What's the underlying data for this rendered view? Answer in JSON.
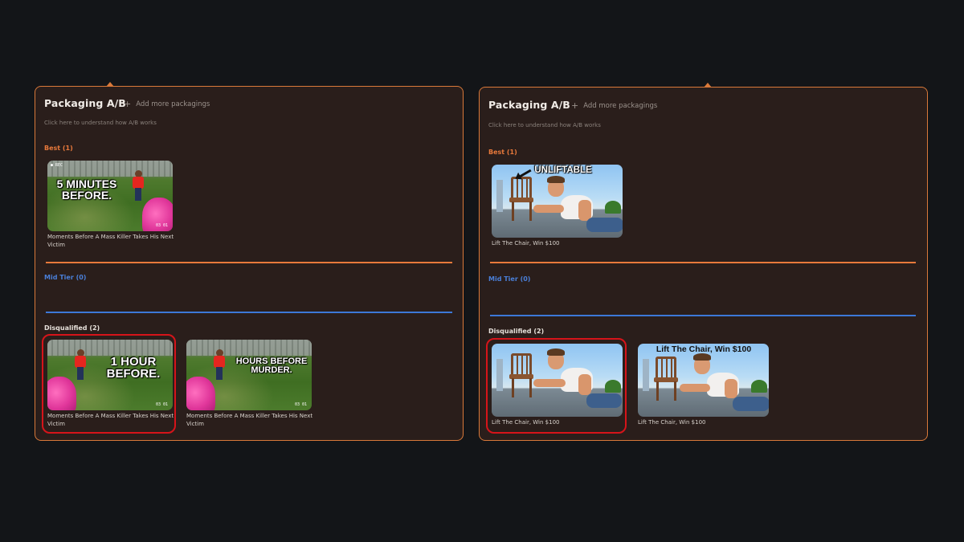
{
  "panels": [
    {
      "title": "Packaging A/B",
      "add_more_label": "Add more packagings",
      "help_text": "Click here to understand how A/B works",
      "tiers": {
        "best": "Best (1)",
        "mid": "Mid Tier (0)",
        "disqualified": "Disqualified (2)"
      },
      "best_cards": [
        {
          "thumb_text": "5 MINUTES BEFORE.",
          "title": "Moments Before A Mass Killer Takes His Next Victim"
        }
      ],
      "disqualified_cards": [
        {
          "thumb_text": "1 HOUR BEFORE.",
          "title": "Moments Before A Mass Killer Takes His Next Victim",
          "highlighted": true
        },
        {
          "thumb_text": "HOURS BEFORE MURDER.",
          "title": "Moments Before A Mass Killer Takes His Next Victim",
          "highlighted": false
        }
      ]
    },
    {
      "title": "Packaging A/B",
      "add_more_label": "Add more packagings",
      "help_text": "Click here to understand how A/B works",
      "tiers": {
        "best": "Best (1)",
        "mid": "Mid Tier (0)",
        "disqualified": "Disqualified (2)"
      },
      "best_cards": [
        {
          "thumb_text": "UNLIFTABLE",
          "title": "Lift The Chair, Win $100"
        }
      ],
      "disqualified_cards": [
        {
          "thumb_text": "",
          "title": "Lift The Chair, Win $100",
          "highlighted": true
        },
        {
          "thumb_text": "Lift The Chair, Win $100",
          "title": "Lift The Chair, Win $100",
          "highlighted": false
        }
      ]
    }
  ],
  "colors": {
    "background": "#131518",
    "panel": "#2a1e1b",
    "accent_orange": "#e8793b",
    "accent_blue": "#3c78d8",
    "highlight_red": "#d6141a"
  }
}
